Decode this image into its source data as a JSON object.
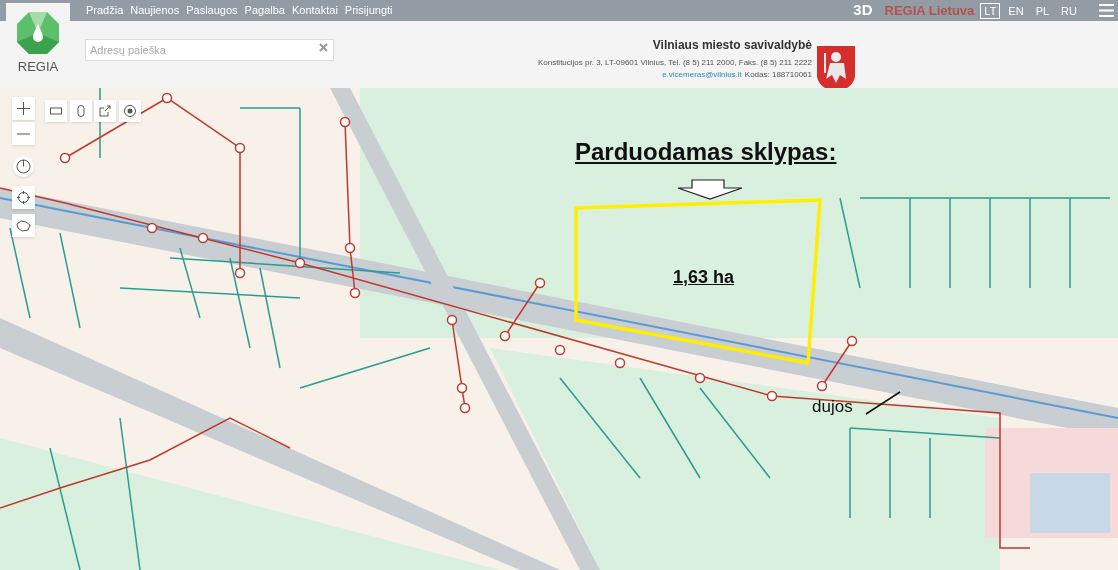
{
  "logo": {
    "text": "REGIA"
  },
  "nav": {
    "items": [
      "Pradžia",
      "Naujienos",
      "Paslaugos",
      "Pagalba",
      "Kontaktai",
      "Prisijungti"
    ]
  },
  "toolbar_right": {
    "mode_3d": "3D",
    "brand": "REGIA Lietuva",
    "languages": [
      {
        "label": "LT",
        "selected": true
      },
      {
        "label": "EN",
        "selected": false
      },
      {
        "label": "PL",
        "selected": false
      },
      {
        "label": "RU",
        "selected": false
      }
    ]
  },
  "search": {
    "placeholder": "Adresų paieška"
  },
  "municipality": {
    "name": "Vilniaus miesto savivaldybė",
    "address": "Konstitucijos pr. 3, LT-09601 Vilnius, Tel. (8 5) 211 2000, Faks. (8 5) 211 2222",
    "email": "e.vicemeras@vilnius.lt",
    "code": "Kodas: 188710061"
  },
  "map": {
    "title": "Parduodamas sklypas:",
    "area": "1,63 ha",
    "gas_label": "dujos"
  }
}
